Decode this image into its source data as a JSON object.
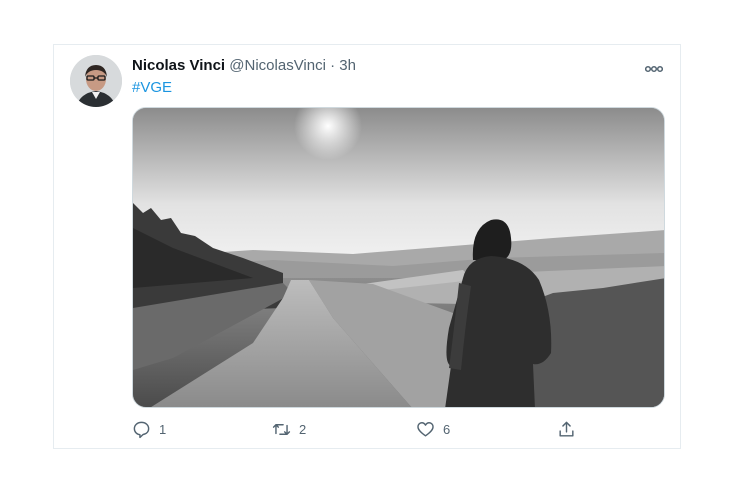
{
  "tweet": {
    "author_name": "Nicolas Vinci",
    "author_handle": "@NicolasVinci",
    "separator": "·",
    "time": "3h",
    "text": "#VGE",
    "more_icon": "more-horizontal-icon"
  },
  "actions": {
    "reply": {
      "icon": "reply-icon",
      "count": "1"
    },
    "retweet": {
      "icon": "retweet-icon",
      "count": "2"
    },
    "like": {
      "icon": "like-icon",
      "count": "6"
    },
    "share": {
      "icon": "share-icon"
    }
  },
  "colors": {
    "hashtag": "#1b95e0",
    "secondary_text": "#536471",
    "border": "#e6ecf0"
  }
}
